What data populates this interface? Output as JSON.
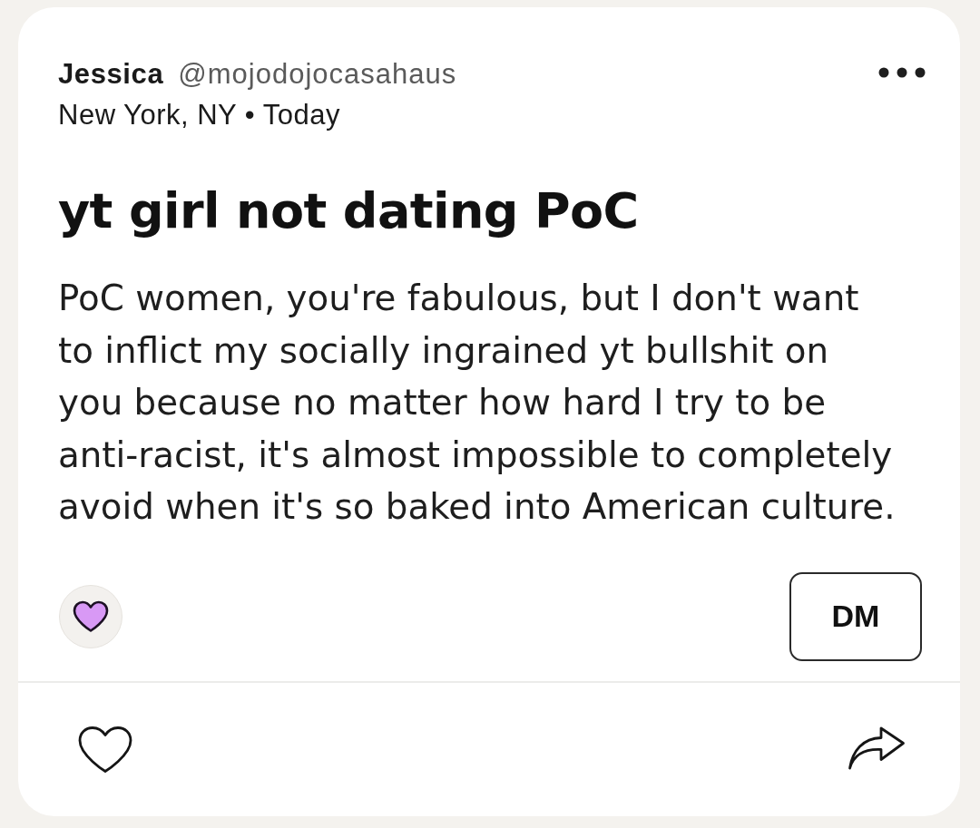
{
  "author": {
    "name": "Jessica",
    "handle": "@mojodojocasahaus"
  },
  "meta": "New York, NY • Today",
  "post": {
    "title": "yt girl not dating PoC",
    "body": "PoC women, you're fabulous, but I don't want to inflict my socially ingrained yt bullshit on you because no matter how hard I try to be anti-racist, it's almost impossible to completely avoid when it's so baked into American culture."
  },
  "dm_button": "DM",
  "footer": {
    "liked": false
  }
}
